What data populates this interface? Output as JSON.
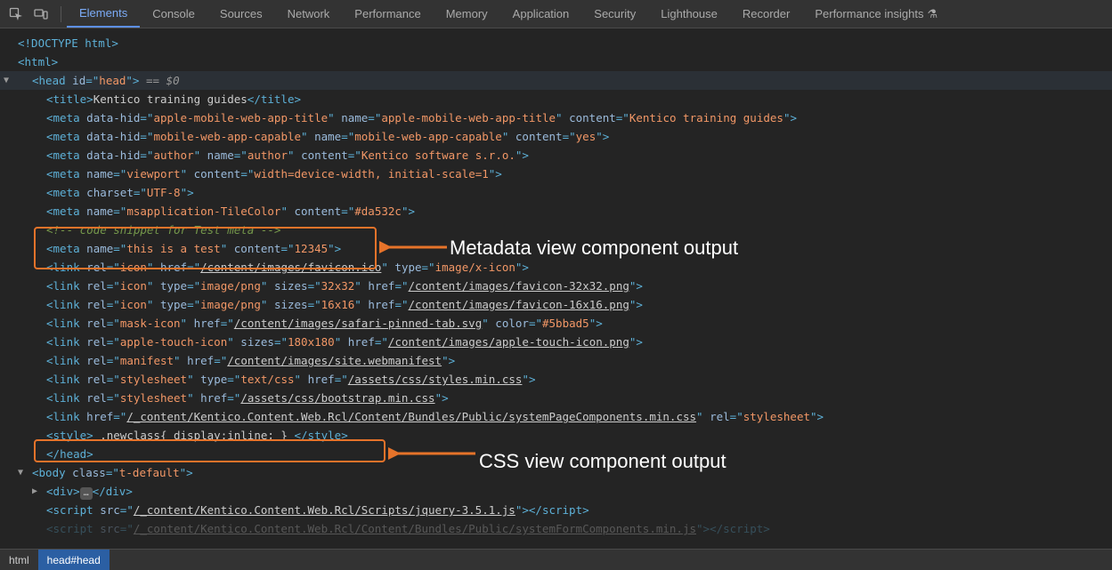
{
  "toolbar": {
    "tabs": [
      "Elements",
      "Console",
      "Sources",
      "Network",
      "Performance",
      "Memory",
      "Application",
      "Security",
      "Lighthouse",
      "Recorder",
      "Performance insights"
    ]
  },
  "code": {
    "doctype": "<!DOCTYPE html>",
    "html_open": "html",
    "head_open_tag": "head",
    "head_id_attr": "id",
    "head_id_val": "head",
    "sel_marker": " == $0",
    "title_tag": "title",
    "title_text": "Kentico training guides",
    "m1_tag": "meta",
    "m1_a1n": "data-hid",
    "m1_a1v": "apple-mobile-web-app-title",
    "m1_a2n": "name",
    "m1_a2v": "apple-mobile-web-app-title",
    "m1_a3n": "content",
    "m1_a3v": "Kentico training guides",
    "m2_a1n": "data-hid",
    "m2_a1v": "mobile-web-app-capable",
    "m2_a2n": "name",
    "m2_a2v": "mobile-web-app-capable",
    "m2_a3n": "content",
    "m2_a3v": "yes",
    "m3_a1n": "data-hid",
    "m3_a1v": "author",
    "m3_a2n": "name",
    "m3_a2v": "author",
    "m3_a3n": "content",
    "m3_a3v": "Kentico software s.r.o.",
    "m4_a1n": "name",
    "m4_a1v": "viewport",
    "m4_a2n": "content",
    "m4_a2v": "width=device-width, initial-scale=1",
    "m5_a1n": "charset",
    "m5_a1v": "UTF-8",
    "m6_a1n": "name",
    "m6_a1v": "msapplication-TileColor",
    "m6_a2n": "content",
    "m6_a2v": "#da532c",
    "comment": "<!-- code snippet for Test meta -->",
    "m7_a1n": "name",
    "m7_a1v": "this is a test",
    "m7_a2n": "content",
    "m7_a2v": "12345",
    "l1_a1n": "rel",
    "l1_a1v": "icon",
    "l1_a2n": "href",
    "l1_hrefv": "/content/images/favicon.ico",
    "l1_a3n": "type",
    "l1_a3v": "image/x-icon",
    "l2_a1v": "icon",
    "l2_a2n": "type",
    "l2_a2v": "image/png",
    "l2_a3n": "sizes",
    "l2_a3v": "32x32",
    "l2_hrefv": "/content/images/favicon-32x32.png",
    "l3_a3v": "16x16",
    "l3_hrefv": "/content/images/favicon-16x16.png",
    "l4_a1v": "mask-icon",
    "l4_hrefv": "/content/images/safari-pinned-tab.svg",
    "l4_a3n": "color",
    "l4_a3v": "#5bbad5",
    "l5_a1v": "apple-touch-icon",
    "l5_a2n": "sizes",
    "l5_a2v": "180x180",
    "l5_hrefv": "/content/images/apple-touch-icon.png",
    "l6_a1v": "manifest",
    "l6_hrefv": "/content/images/site.webmanifest",
    "l7_a1v": "stylesheet",
    "l7_a2n": "type",
    "l7_a2v": "text/css",
    "l7_hrefv": "/assets/css/styles.min.css",
    "l8_a1v": "stylesheet",
    "l8_hrefv": "/assets/css/bootstrap.min.css",
    "l9_hrefv": "/_content/Kentico.Content.Web.Rcl/Content/Bundles/Public/systemPageComponents.min.css",
    "l9_a2v": "stylesheet",
    "style_tag": "style",
    "style_text": " .newclass{ display:inline; } ",
    "head_close": "head",
    "body_tag": "body",
    "body_an": "class",
    "body_av": "t-default",
    "div_tag": "div",
    "div_ell": "…",
    "script_tag": "script",
    "script_an": "src",
    "script_hrefv": "/_content/Kentico.Content.Web.Rcl/Scripts/jquery-3.5.1.js",
    "script2_partial": "/_content/Kentico.Content.Web.Rcl/Content/Bundles/Public/systemFormComponents.min.js"
  },
  "callouts": {
    "metadata": "Metadata view component output",
    "css": "CSS view component output"
  },
  "breadcrumb": {
    "items": [
      "html",
      "head#head"
    ]
  }
}
